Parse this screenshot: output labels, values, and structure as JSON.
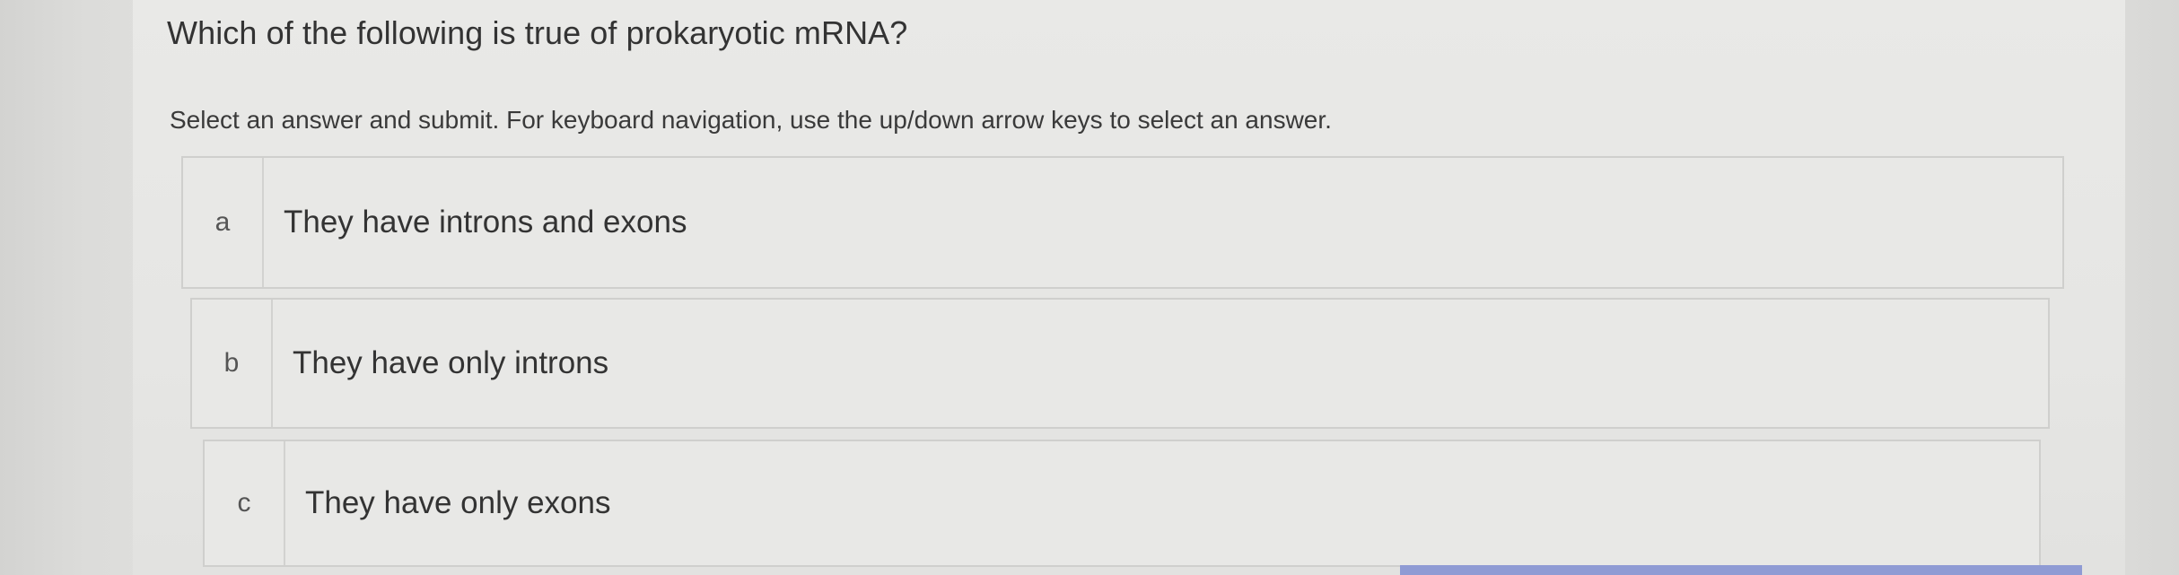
{
  "question": {
    "text": "Which of the following is true of prokaryotic mRNA?"
  },
  "instructions": {
    "text": "Select an answer and submit. For keyboard navigation, use the up/down arrow keys to select an answer."
  },
  "choices": [
    {
      "letter": "a",
      "text": "They have introns and exons"
    },
    {
      "letter": "b",
      "text": "They have only introns"
    },
    {
      "letter": "c",
      "text": "They have only exons"
    }
  ],
  "colors": {
    "background": "#e3e3e1",
    "text": "#333333",
    "border": "#cfcfcd",
    "accent": "#8f9bd4"
  }
}
